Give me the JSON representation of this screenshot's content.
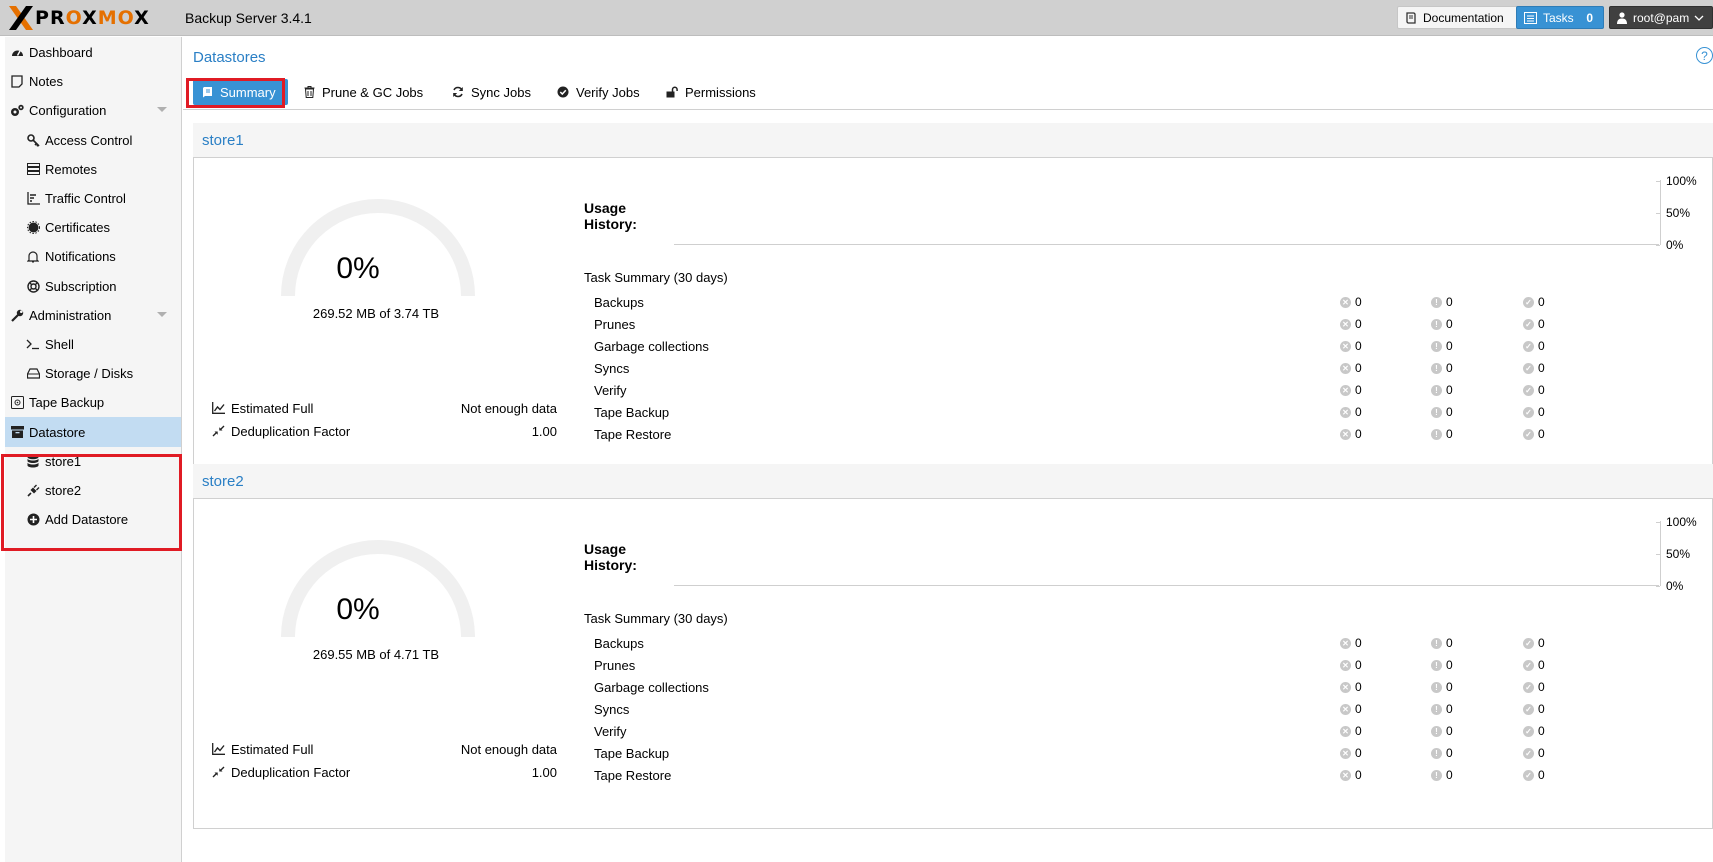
{
  "header": {
    "brand": "PROXMOX",
    "product": "Backup Server 3.4.1",
    "documentation_label": "Documentation",
    "tasks_label": "Tasks",
    "tasks_count": "0",
    "user_label": "root@pam"
  },
  "sidebar": {
    "items": [
      {
        "label": "Dashboard",
        "icon": "dashboard-icon"
      },
      {
        "label": "Notes",
        "icon": "notes-icon"
      },
      {
        "label": "Configuration",
        "icon": "gears-icon"
      },
      {
        "label": "Access Control",
        "icon": "key-icon"
      },
      {
        "label": "Remotes",
        "icon": "server-icon"
      },
      {
        "label": "Traffic Control",
        "icon": "signal-icon"
      },
      {
        "label": "Certificates",
        "icon": "certificate-icon"
      },
      {
        "label": "Notifications",
        "icon": "bell-icon"
      },
      {
        "label": "Subscription",
        "icon": "life-ring-icon"
      },
      {
        "label": "Administration",
        "icon": "wrench-icon"
      },
      {
        "label": "Shell",
        "icon": "terminal-icon"
      },
      {
        "label": "Storage / Disks",
        "icon": "hdd-icon"
      },
      {
        "label": "Tape Backup",
        "icon": "tape-icon"
      },
      {
        "label": "Datastore",
        "icon": "archive-icon"
      },
      {
        "label": "store1",
        "icon": "database-icon"
      },
      {
        "label": "store2",
        "icon": "plug-icon"
      },
      {
        "label": "Add Datastore",
        "icon": "plus-circle-icon"
      }
    ]
  },
  "main": {
    "title": "Datastores",
    "help": "?",
    "tabs": [
      {
        "label": "Summary",
        "icon": "book-icon"
      },
      {
        "label": "Prune & GC Jobs",
        "icon": "trash-icon"
      },
      {
        "label": "Sync Jobs",
        "icon": "refresh-icon"
      },
      {
        "label": "Verify Jobs",
        "icon": "check-circle-icon"
      },
      {
        "label": "Permissions",
        "icon": "unlock-icon"
      }
    ],
    "stores": [
      {
        "name": "store1",
        "usage_percent_label": "0%",
        "usage_fraction": 0,
        "usage_text": "269.52 MB of 3.74 TB",
        "estimated_full_label": "Estimated Full",
        "estimated_full_value": "Not enough data",
        "dedup_label": "Deduplication Factor",
        "dedup_value": "1.00",
        "usage_history_label": "Usage History:",
        "chart_ticks": [
          "100%",
          "50%",
          "0%"
        ],
        "task_summary_title": "Task Summary (30 days)",
        "tasks": [
          {
            "name": "Backups",
            "error": "0",
            "warning": "0",
            "ok": "0"
          },
          {
            "name": "Prunes",
            "error": "0",
            "warning": "0",
            "ok": "0"
          },
          {
            "name": "Garbage collections",
            "error": "0",
            "warning": "0",
            "ok": "0"
          },
          {
            "name": "Syncs",
            "error": "0",
            "warning": "0",
            "ok": "0"
          },
          {
            "name": "Verify",
            "error": "0",
            "warning": "0",
            "ok": "0"
          },
          {
            "name": "Tape Backup",
            "error": "0",
            "warning": "0",
            "ok": "0"
          },
          {
            "name": "Tape Restore",
            "error": "0",
            "warning": "0",
            "ok": "0"
          }
        ]
      },
      {
        "name": "store2",
        "usage_percent_label": "0%",
        "usage_fraction": 0,
        "usage_text": "269.55 MB of 4.71 TB",
        "estimated_full_label": "Estimated Full",
        "estimated_full_value": "Not enough data",
        "dedup_label": "Deduplication Factor",
        "dedup_value": "1.00",
        "usage_history_label": "Usage History:",
        "chart_ticks": [
          "100%",
          "50%",
          "0%"
        ],
        "task_summary_title": "Task Summary (30 days)",
        "tasks": [
          {
            "name": "Backups",
            "error": "0",
            "warning": "0",
            "ok": "0"
          },
          {
            "name": "Prunes",
            "error": "0",
            "warning": "0",
            "ok": "0"
          },
          {
            "name": "Garbage collections",
            "error": "0",
            "warning": "0",
            "ok": "0"
          },
          {
            "name": "Syncs",
            "error": "0",
            "warning": "0",
            "ok": "0"
          },
          {
            "name": "Verify",
            "error": "0",
            "warning": "0",
            "ok": "0"
          },
          {
            "name": "Tape Backup",
            "error": "0",
            "warning": "0",
            "ok": "0"
          },
          {
            "name": "Tape Restore",
            "error": "0",
            "warning": "0",
            "ok": "0"
          }
        ]
      }
    ]
  },
  "colors": {
    "accent": "#3892d4",
    "link": "#2a7fc5",
    "selected": "#c2dcf2",
    "highlight": "#e01b24",
    "brand_orange": "#e57000"
  }
}
